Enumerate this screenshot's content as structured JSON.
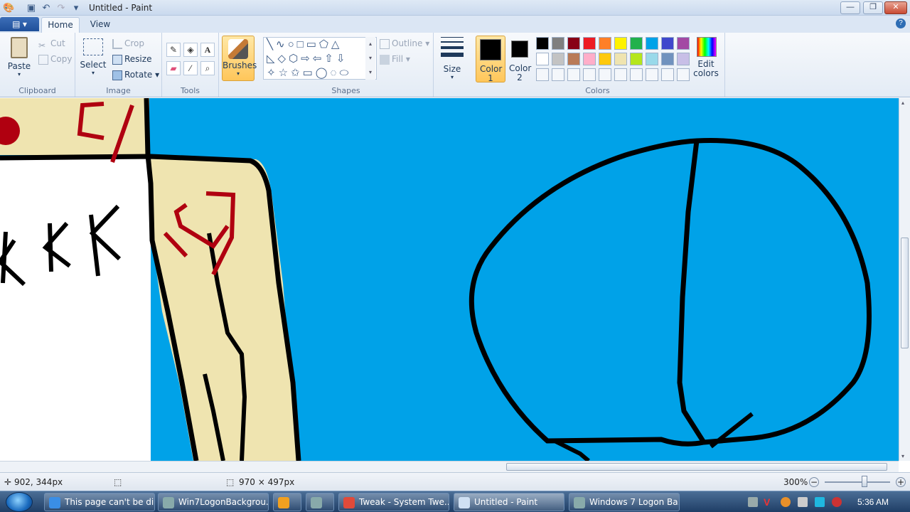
{
  "window": {
    "title": "Untitled - Paint",
    "minimize": "—",
    "maximize": "❐",
    "close": "✕"
  },
  "quick_access": {
    "save_icon": "save-icon",
    "undo_icon": "undo-icon",
    "redo_icon": "redo-icon"
  },
  "tabs": {
    "file": "▤ ▾",
    "home": "Home",
    "view": "View",
    "help": "?"
  },
  "clipboard": {
    "paste": "Paste",
    "cut": "Cut",
    "copy": "Copy",
    "label": "Clipboard"
  },
  "image": {
    "select": "Select",
    "crop": "Crop",
    "resize": "Resize",
    "rotate": "Rotate",
    "label": "Image"
  },
  "tools": {
    "label": "Tools",
    "text_tool": "A"
  },
  "brushes": {
    "label": "Brushes"
  },
  "shapes": {
    "outline": "Outline",
    "fill": "Fill",
    "label": "Shapes"
  },
  "size": {
    "label": "Size"
  },
  "colors": {
    "color1": "Color 1",
    "color2": "Color 2",
    "color1_value": "#000000",
    "color2_value": "#000000",
    "edit": "Edit colors",
    "label": "Colors",
    "palette_row1": [
      "#000000",
      "#7f7f7f",
      "#880015",
      "#ed1c24",
      "#ff7f27",
      "#fff200",
      "#22b14c",
      "#00a2e8",
      "#3f48cc",
      "#a349a4"
    ],
    "palette_row2": [
      "#ffffff",
      "#c3c3c3",
      "#b97a57",
      "#ffaec9",
      "#ffc90e",
      "#efe4b0",
      "#b5e61d",
      "#99d9ea",
      "#7092be",
      "#c8bfe7"
    ]
  },
  "canvas": {
    "background": "#00a2e8"
  },
  "status": {
    "cursor_pos": "902, 344px",
    "canvas_size": "970 × 497px",
    "zoom": "300%"
  },
  "taskbar": {
    "items": [
      {
        "label": "This page can't be di...",
        "icon": "ie-icon"
      },
      {
        "label": "Win7LogonBackgrou...",
        "icon": "app-icon"
      },
      {
        "label": "",
        "icon": "media-player-icon"
      },
      {
        "label": "",
        "icon": "app-icon"
      },
      {
        "label": "Tweak - System Twe...",
        "icon": "chrome-icon"
      },
      {
        "label": "Untitled - Paint",
        "icon": "paint-icon"
      },
      {
        "label": "Windows 7 Logon Ba...",
        "icon": "app-icon"
      }
    ],
    "clock": "5:36 AM"
  }
}
